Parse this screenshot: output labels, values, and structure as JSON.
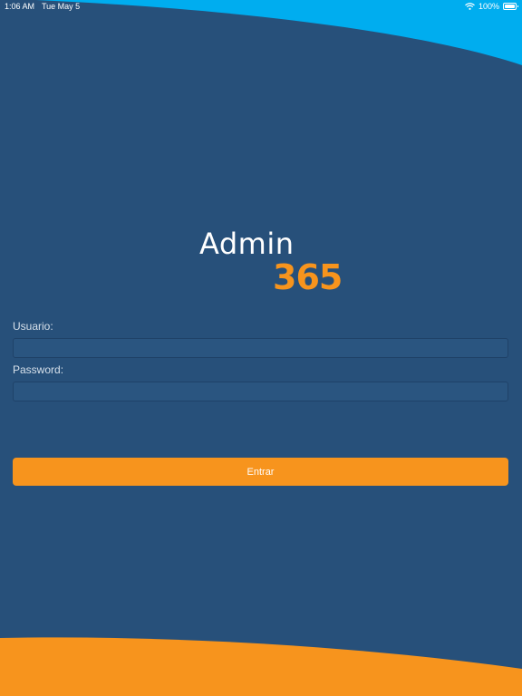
{
  "status_bar": {
    "time": "1:06 AM",
    "date": "Tue May 5",
    "battery_text": "100%",
    "battery_level": 1.0,
    "wifi_icon": "wifi-icon",
    "battery_icon": "battery-icon"
  },
  "logo": {
    "word": "Admin",
    "number": "365"
  },
  "form": {
    "username_label": "Usuario:",
    "username_value": "",
    "password_label": "Password:",
    "password_value": "",
    "submit_label": "Entrar"
  },
  "colors": {
    "background": "#27507a",
    "top_wave": "#00adef",
    "bottom_wave": "#f7941d",
    "accent": "#f7941d",
    "text_on_dark": "#ffffff"
  }
}
